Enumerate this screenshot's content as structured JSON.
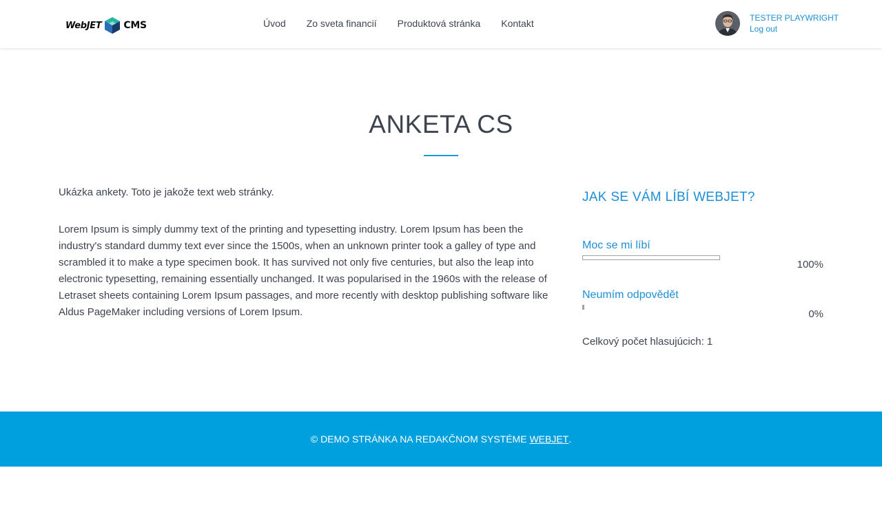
{
  "header": {
    "logo": {
      "left": "WebJET",
      "right": "CMS"
    },
    "nav": [
      "Úvod",
      "Zo sveta financií",
      "Produktová stránka",
      "Kontakt"
    ],
    "user": {
      "name": "TESTER PLAYWRIGHT",
      "logout": "Log out"
    }
  },
  "page": {
    "title": "ANKETA CS",
    "intro": "Ukázka ankety. Toto je jakože text web stránky.",
    "body": "Lorem Ipsum is simply dummy text of the printing and typesetting industry. Lorem Ipsum has been the industry's standard dummy text ever since the 1500s, when an unknown printer took a galley of type and scrambled it to make a type specimen book. It has survived not only five centuries, but also the leap into electronic typesetting, remaining essentially unchanged. It was popularised in the 1960s with the release of Letraset sheets containing Lorem Ipsum passages, and more recently with desktop publishing software like Aldus PageMaker including versions of Lorem Ipsum."
  },
  "poll": {
    "question": "JAK SE VÁM LÍBÍ WEBJET?",
    "options": [
      {
        "label": "Moc se mi líbí",
        "percent_text": "100%",
        "percent": 100
      },
      {
        "label": "Neumím odpovědět",
        "percent_text": "0%",
        "percent": 0
      }
    ],
    "voters": "Celkový počet hlasujúcich: 1"
  },
  "footer": {
    "text": "© DEMO STRÁNKA NA REDAKČNOM SYSTÉME ",
    "link": "WEBJET",
    "suffix": "."
  },
  "colors": {
    "accent": "#1d8fd6",
    "footer_bg": "#009fdd",
    "text": "#3d4450"
  },
  "icons": {
    "logo_mark": "webjet-cube-icon",
    "avatar": "user-avatar-photo"
  }
}
